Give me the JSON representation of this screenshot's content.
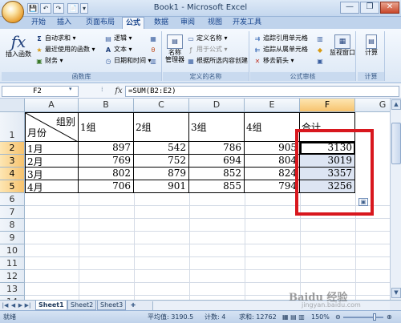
{
  "window": {
    "title": "Book1 - Microsoft Excel",
    "controls": {
      "minimize": "—",
      "restore": "❐",
      "close": "✕"
    },
    "qat": [
      "💾",
      "↶",
      "↷",
      "📄",
      "▾"
    ]
  },
  "ribbon": {
    "tabs": [
      "开始",
      "插入",
      "页面布局",
      "公式",
      "数据",
      "审阅",
      "视图",
      "开发工具"
    ],
    "active_tab": "公式",
    "groups": {
      "library": {
        "label": "函数库",
        "insert_function": "插入函数",
        "autosum": "自动求和",
        "recent": "最近使用的函数",
        "financial": "财务",
        "logical": "逻辑",
        "text": "文本",
        "datetime": "日期和时间"
      },
      "names": {
        "label": "定义的名称",
        "name_manager": "名称\n管理器",
        "define_name": "定义名称",
        "use_in_formula": "用于公式",
        "create_from_selection": "根据所选内容创建"
      },
      "audit": {
        "label": "公式审核",
        "trace_precedents": "追踪引用单元格",
        "trace_dependents": "追踪从属单元格",
        "remove_arrows": "移去箭头",
        "watch_window": "监视窗口"
      },
      "calc": {
        "label": "计算"
      }
    }
  },
  "formula_bar": {
    "name_box": "F2",
    "fx": "fx",
    "formula": "=SUM(B2:E2)"
  },
  "sheet": {
    "columns": [
      "A",
      "B",
      "C",
      "D",
      "E",
      "F",
      "G"
    ],
    "selected_column": "F",
    "rows": [
      "1",
      "2",
      "3",
      "4",
      "5",
      "6",
      "7",
      "8",
      "9",
      "10",
      "11",
      "12",
      "13",
      "14"
    ],
    "header_row": {
      "a_top": "组别",
      "a_bottom": "月份",
      "groups": [
        "1组",
        "2组",
        "3组",
        "4组"
      ],
      "total": "合计"
    },
    "data": [
      {
        "month": "1月",
        "values": [
          "897",
          "542",
          "786",
          "905"
        ],
        "total": "3130"
      },
      {
        "month": "2月",
        "values": [
          "769",
          "752",
          "694",
          "804"
        ],
        "total": "3019"
      },
      {
        "month": "3月",
        "values": [
          "802",
          "879",
          "852",
          "824"
        ],
        "total": "3357"
      },
      {
        "month": "4月",
        "values": [
          "706",
          "901",
          "855",
          "794"
        ],
        "total": "3256"
      }
    ]
  },
  "sheet_tabs": [
    "Sheet1",
    "Sheet2",
    "Sheet3"
  ],
  "active_sheet": "Sheet1",
  "status": {
    "ready": "就绪",
    "average": "平均值: 3190.5",
    "count": "计数: 4",
    "sum": "求和: 12762",
    "zoom": "150%"
  },
  "watermark": {
    "main": "Baidu 经验",
    "sub": "jingyan.baidu.com"
  },
  "colors": {
    "highlight": "#d8171e",
    "selection": "#dde5f3",
    "header_sel": "#f7c36e"
  }
}
